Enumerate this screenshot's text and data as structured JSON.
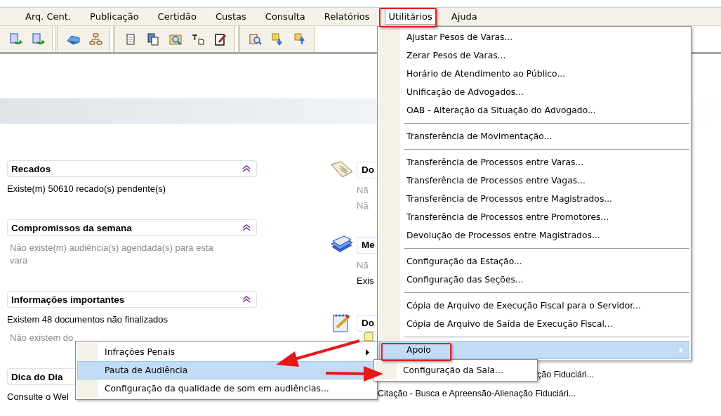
{
  "menubar": {
    "items": [
      {
        "label": "Arq. Cent.",
        "selected": false
      },
      {
        "label": "Publicação",
        "selected": false
      },
      {
        "label": "Certidão",
        "selected": false
      },
      {
        "label": "Custas",
        "selected": false
      },
      {
        "label": "Consulta",
        "selected": false
      },
      {
        "label": "Relatórios",
        "selected": false
      },
      {
        "label": "Utilitários",
        "selected": true
      },
      {
        "label": "Ajuda",
        "selected": false
      }
    ]
  },
  "dashboard": {
    "panels": [
      {
        "title": "Recados",
        "collapse_button": true,
        "lines": [
          {
            "text": "Existe(m) 50610 recado(s) pendente(s)",
            "muted": false
          }
        ]
      },
      {
        "title": "Compromissos da semana",
        "collapse_button": true,
        "lines": [
          {
            "text": "Não existe(m) audiência(s) agendada(s) para esta vara",
            "muted": true
          }
        ]
      },
      {
        "title": "Informações importantes",
        "collapse_button": true,
        "lines": [
          {
            "text": "Existem 48 documentos não finalizados",
            "muted": false
          },
          {
            "text": "Não existem do",
            "muted": true
          }
        ]
      },
      {
        "title": "Dica do Dia",
        "lines": [
          {
            "text": "Consulte o Wel",
            "muted": false
          }
        ]
      }
    ],
    "side_panels": [
      {
        "kind": "book",
        "title": "Do",
        "lines": [
          {
            "text": "Nã",
            "muted": true
          },
          {
            "text": "Nã",
            "muted": true
          }
        ]
      },
      {
        "kind": "stack",
        "title": "Me",
        "lines": [
          {
            "text": "Nã",
            "muted": true
          },
          {
            "text": "Exis",
            "muted": false
          }
        ]
      },
      {
        "kind": "notepad",
        "title": "Do"
      }
    ]
  },
  "utilities_menu": {
    "items": [
      {
        "kind": "command",
        "label": "Ajustar Pesos de Varas...",
        "selected": false,
        "submenu": false
      },
      {
        "kind": "command",
        "label": "Zerar Pesos de Varas...",
        "selected": false,
        "submenu": false
      },
      {
        "kind": "command",
        "label": "Horário de Atendimento ao Público...",
        "selected": false,
        "submenu": false
      },
      {
        "kind": "command",
        "label": "Unificação de Advogados...",
        "selected": false,
        "submenu": false
      },
      {
        "kind": "command",
        "label": "OAB - Alteração da Situação do Advogado...",
        "selected": false,
        "submenu": false
      },
      {
        "kind": "separator"
      },
      {
        "kind": "command",
        "label": "Transferência de Movimentação...",
        "selected": false,
        "submenu": false
      },
      {
        "kind": "separator"
      },
      {
        "kind": "command",
        "label": "Transferência de Processos entre Varas...",
        "selected": false,
        "submenu": false
      },
      {
        "kind": "command",
        "label": "Transferência de Processos entre Vagas...",
        "selected": false,
        "submenu": false
      },
      {
        "kind": "command",
        "label": "Transferência de Processos entre Magistrados...",
        "selected": false,
        "submenu": false
      },
      {
        "kind": "command",
        "label": "Transferência de Processos entre Promotores...",
        "selected": false,
        "submenu": false
      },
      {
        "kind": "command",
        "label": "Devolução de Processos entre Magistrados...",
        "selected": false,
        "submenu": false
      },
      {
        "kind": "separator"
      },
      {
        "kind": "command",
        "label": "Configuração da Estação...",
        "selected": false,
        "submenu": false
      },
      {
        "kind": "command",
        "label": "Configuração das Seções...",
        "selected": false,
        "submenu": false
      },
      {
        "kind": "separator"
      },
      {
        "kind": "command",
        "label": "Cópia de Arquivo de Execução Fiscal para o Servidor...",
        "selected": false,
        "submenu": false
      },
      {
        "kind": "command",
        "label": "Cópia de Arquivo de Saída de Execução Fiscal...",
        "selected": false,
        "submenu": false
      },
      {
        "kind": "separator"
      },
      {
        "kind": "command",
        "label": "Apoio",
        "selected": true,
        "submenu": true
      }
    ]
  },
  "apoio_submenu": {
    "items": [
      {
        "kind": "command",
        "label": "Configuração da Sala...",
        "selected": false,
        "submenu": false
      }
    ]
  },
  "context_menu": {
    "items": [
      {
        "kind": "command",
        "label": "Infrações Penais",
        "selected": false,
        "submenu": true
      },
      {
        "kind": "command",
        "label": "Pauta de Audiência",
        "selected": true,
        "submenu": false
      },
      {
        "kind": "command",
        "label": "Configuração da qualidade de som em audiências...",
        "selected": false,
        "submenu": false
      }
    ]
  },
  "background_texts": [
    "ção Fiduciári...",
    "Citação - Busca e Apreensão-Alienação Fiduciári..."
  ]
}
